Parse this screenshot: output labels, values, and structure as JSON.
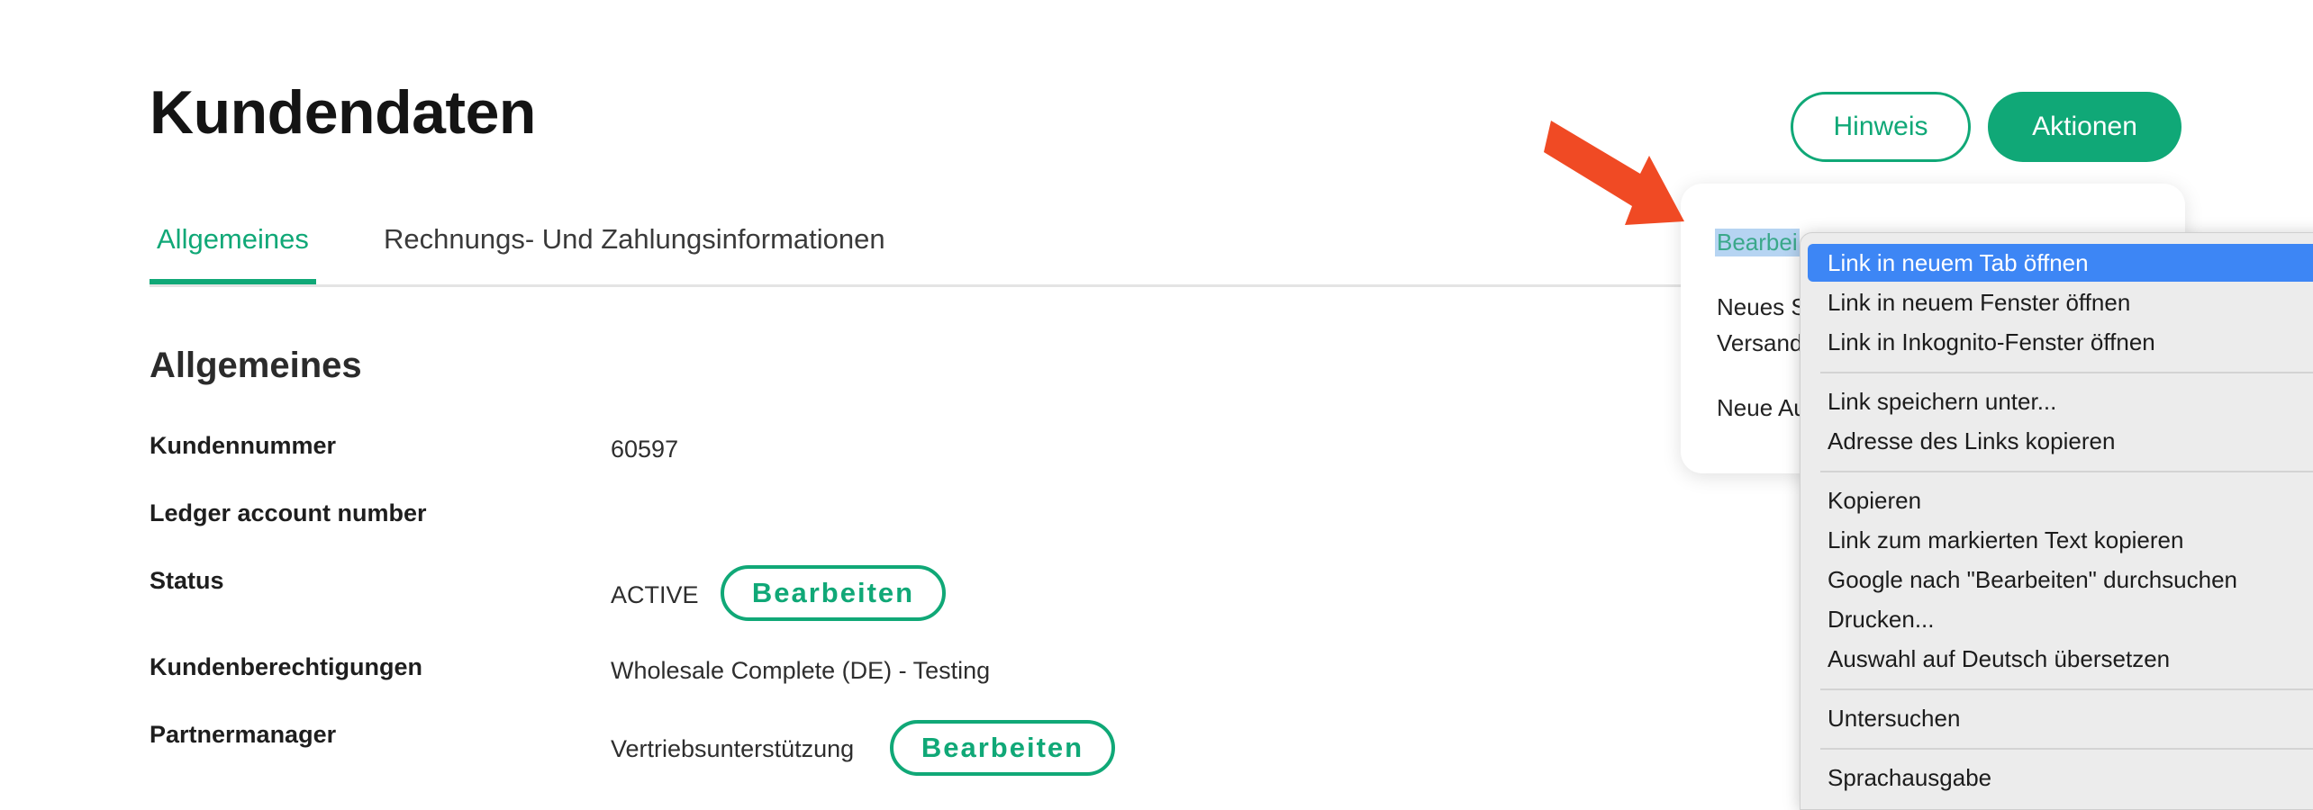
{
  "page": {
    "title": "Kundendaten"
  },
  "header_actions": {
    "hint_label": "Hinweis",
    "actions_label": "Aktionen"
  },
  "tabs": [
    {
      "label": "Allgemeines",
      "active": true
    },
    {
      "label": "Rechnungs- Und Zahlungsinformationen",
      "active": false
    }
  ],
  "section": {
    "title": "Allgemeines"
  },
  "fields": [
    {
      "label": "Kundennummer",
      "value": "60597"
    },
    {
      "label": "Ledger account number",
      "value": ""
    },
    {
      "label": "Status",
      "value": "ACTIVE",
      "action": "Bearbeiten"
    },
    {
      "label": "Kundenberechtigungen",
      "value": "Wholesale Complete (DE) - Testing"
    },
    {
      "label": "Partnermanager",
      "value": "Vertriebsunterstützung",
      "action": "Bearbeiten"
    }
  ],
  "actions_dropdown": {
    "items": [
      "Bearbei",
      "Neues S",
      "Versand",
      "Neue Au"
    ]
  },
  "context_menu": {
    "items": [
      "Link in neuem Tab öffnen",
      "Link in neuem Fenster öffnen",
      "Link in Inkognito-Fenster öffnen",
      "Link speichern unter...",
      "Adresse des Links kopieren",
      "Kopieren",
      "Link zum markierten Text kopieren",
      "Google nach \"Bearbeiten\" durchsuchen",
      "Drucken...",
      "Auswahl auf Deutsch übersetzen",
      "Untersuchen",
      "Sprachausgabe"
    ],
    "highlighted_index": 0
  },
  "colors": {
    "accent": "#10a877",
    "annotation_arrow": "#f04a24",
    "menu_highlight": "#3d86f5",
    "text_selection": "#b6d4f2"
  },
  "icons": {
    "annotation": "arrow-pointer-icon"
  }
}
